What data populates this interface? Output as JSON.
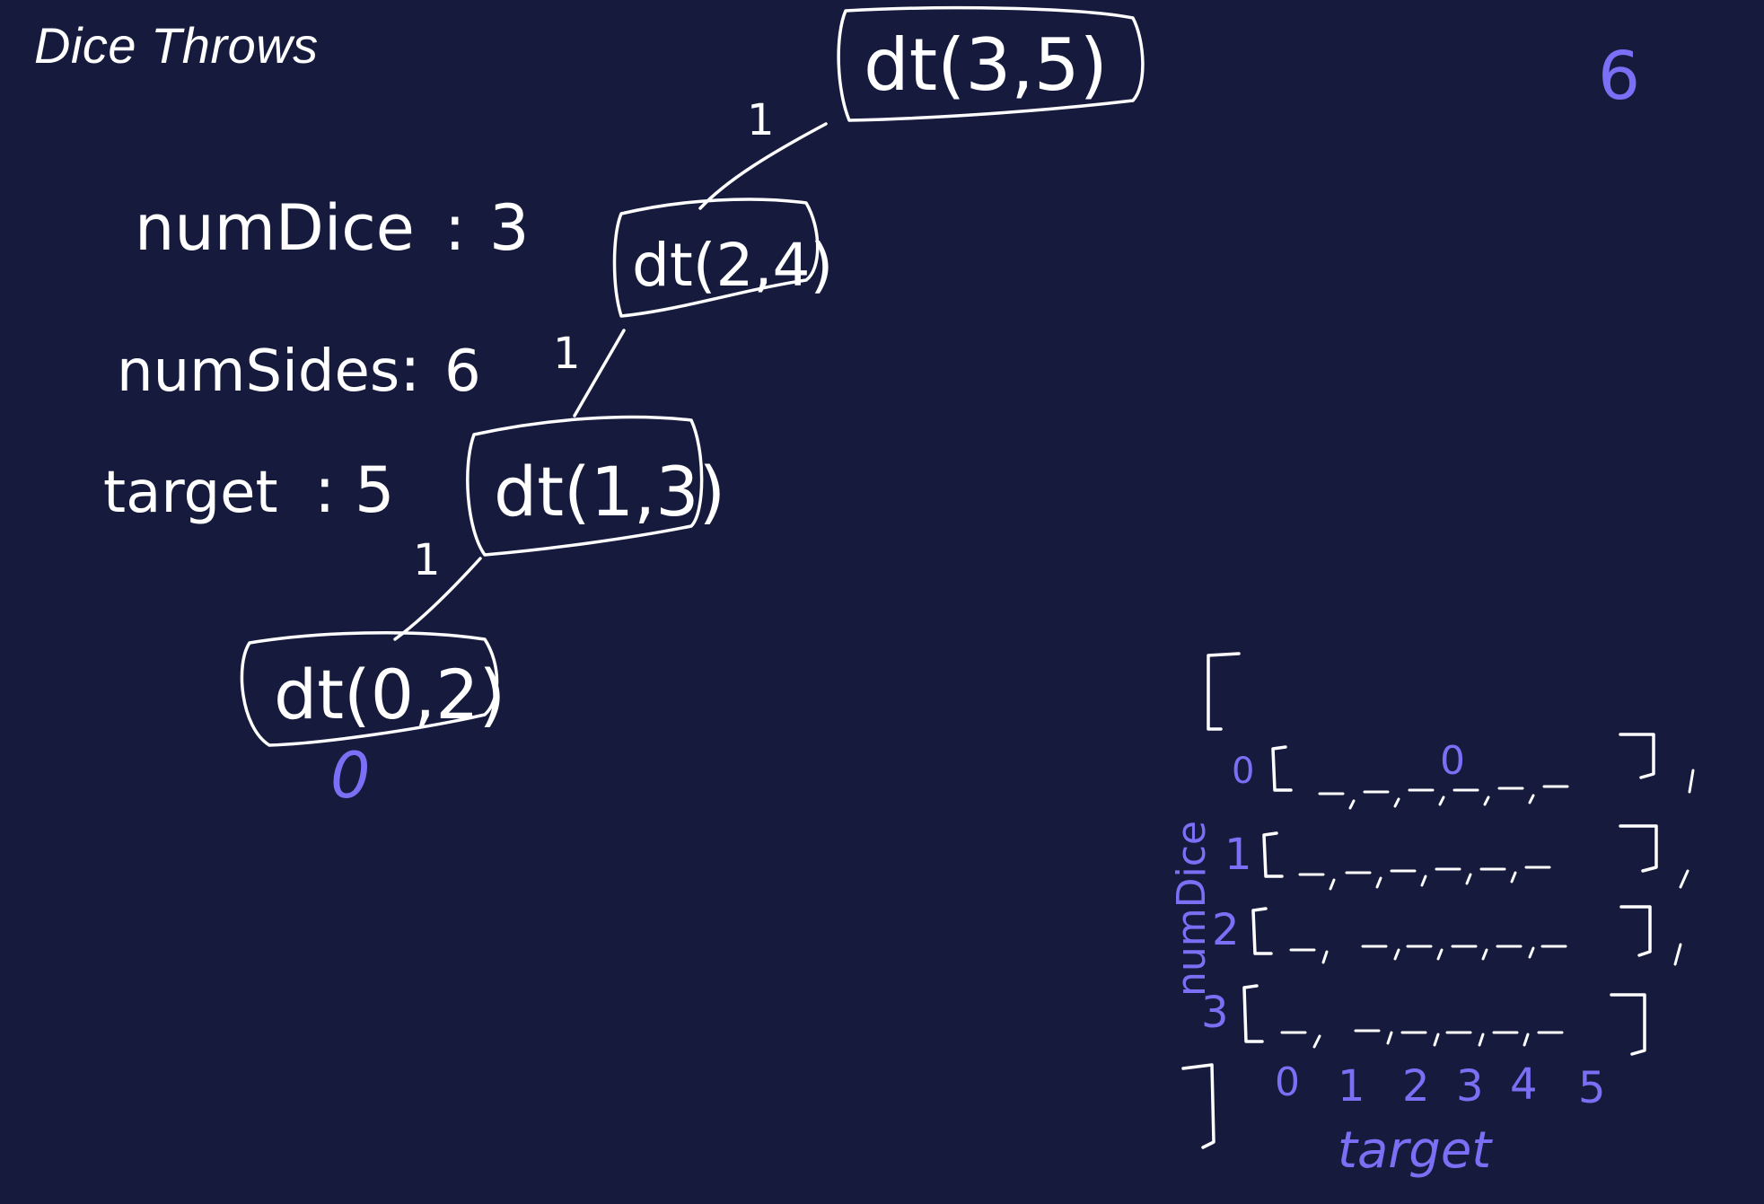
{
  "title": "Dice Throws",
  "colors": {
    "background": "#161b3d",
    "ink": "#ffffff",
    "accent": "#7b6ff5"
  },
  "params": [
    {
      "label": "numDice",
      "value": "3"
    },
    {
      "label": "numSides",
      "value": "6"
    },
    {
      "label": "target",
      "value": "5"
    }
  ],
  "recursion_tree": {
    "nodes": [
      "dt(3,5)",
      "dt(2,4)",
      "dt(1,3)",
      "dt(0,2)"
    ],
    "edge_labels": [
      "1",
      "1",
      "1"
    ],
    "base_result": "0",
    "top_result": "6"
  },
  "memo_table": {
    "row_axis_label": "numDice",
    "col_axis_label": "target",
    "row_indices": [
      "0",
      "1",
      "2",
      "3"
    ],
    "col_indices": [
      "0",
      "1",
      "2",
      "3",
      "4",
      "5"
    ],
    "known_cell": {
      "row": "0",
      "col": "2",
      "value": "0"
    },
    "blank": "_"
  }
}
